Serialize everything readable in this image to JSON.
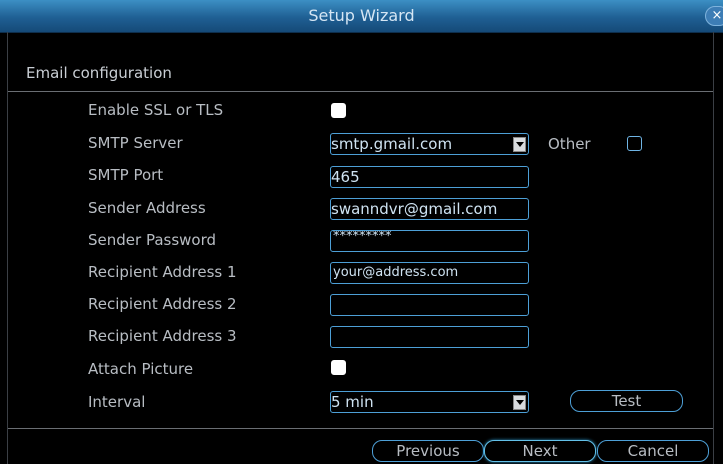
{
  "window": {
    "title": "Setup Wizard",
    "close_label": "×"
  },
  "section": {
    "title": "Email configuration"
  },
  "form": {
    "enable_ssl": {
      "label": "Enable SSL or TLS",
      "checked": true
    },
    "smtp_server": {
      "label": "SMTP Server",
      "value": "smtp.gmail.com"
    },
    "other": {
      "label": "Other",
      "checked": false
    },
    "smtp_port": {
      "label": "SMTP Port",
      "value": "465"
    },
    "sender_address": {
      "label": "Sender Address",
      "value": "swanndvr@gmail.com"
    },
    "sender_password": {
      "label": "Sender Password",
      "value": "*********"
    },
    "recipient_1": {
      "label": "Recipient Address 1",
      "value": "your@address.com"
    },
    "recipient_2": {
      "label": "Recipient Address 2",
      "value": ""
    },
    "recipient_3": {
      "label": "Recipient Address 3",
      "value": ""
    },
    "attach_picture": {
      "label": "Attach Picture",
      "checked": true
    },
    "interval": {
      "label": "Interval",
      "value": "5 min"
    },
    "test_label": "Test"
  },
  "footer": {
    "previous_label": "Previous",
    "next_label": "Next",
    "cancel_label": "Cancel"
  },
  "colors": {
    "accent": "#4d9fd6",
    "titlebar": "#2a72a8",
    "background": "#000000"
  }
}
